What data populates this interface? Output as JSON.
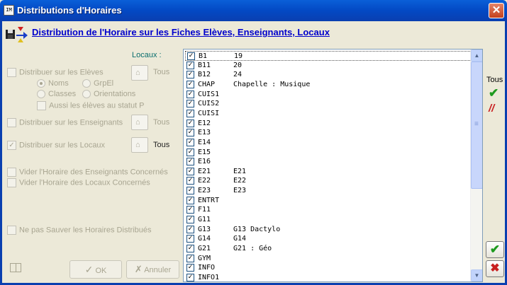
{
  "window": {
    "title": "Distributions d'Horaires",
    "app_icon": "IM",
    "close_symbol": "✕"
  },
  "header": {
    "link_text": "Distribution de l'Horaire sur les Fiches Elèves, Enseignants, Locaux"
  },
  "left": {
    "distribuer_eleves": "Distribuer sur les Elèves",
    "noms": "Noms",
    "grpel": "GrpEl",
    "classes": "Classes",
    "orientations": "Orientations",
    "aussi": "Aussi les élèves au statut P",
    "distribuer_enseignants": "Distribuer sur les Enseignants",
    "distribuer_locaux": "Distribuer sur les Locaux",
    "tous": "Tous",
    "vider_enseignants": "Vider l'Horaire des Enseignants Concernés",
    "vider_locaux": "Vider l'Horaire des Locaux Concernés",
    "ne_pas_sauver": "Ne pas Sauver les Horaires Distribués",
    "ok": "OK",
    "annuler": "Annuler",
    "check_mark": "✓",
    "x_mark": "✗"
  },
  "list": {
    "label": "Locaux :",
    "check_mark": "✓",
    "rows": [
      {
        "code": "B1",
        "desc": "19"
      },
      {
        "code": "B11",
        "desc": "20"
      },
      {
        "code": "B12",
        "desc": "24"
      },
      {
        "code": "CHAP",
        "desc": "Chapelle : Musique"
      },
      {
        "code": "CUIS1",
        "desc": ""
      },
      {
        "code": "CUIS2",
        "desc": ""
      },
      {
        "code": "CUISI",
        "desc": ""
      },
      {
        "code": "E12",
        "desc": ""
      },
      {
        "code": "E13",
        "desc": ""
      },
      {
        "code": "E14",
        "desc": ""
      },
      {
        "code": "E15",
        "desc": ""
      },
      {
        "code": "E16",
        "desc": ""
      },
      {
        "code": "E21",
        "desc": "E21"
      },
      {
        "code": "E22",
        "desc": "E22"
      },
      {
        "code": "E23",
        "desc": "E23"
      },
      {
        "code": "ENTRT",
        "desc": ""
      },
      {
        "code": "F11",
        "desc": ""
      },
      {
        "code": "G11",
        "desc": ""
      },
      {
        "code": "G13",
        "desc": "G13 Dactylo"
      },
      {
        "code": "G14",
        "desc": "G14"
      },
      {
        "code": "G21",
        "desc": "G21 : Géo"
      },
      {
        "code": "GYM",
        "desc": ""
      },
      {
        "code": "INFO",
        "desc": ""
      },
      {
        "code": "INFO1",
        "desc": ""
      }
    ]
  },
  "right": {
    "tous": "Tous",
    "check_mark": "✔",
    "slash_mark": "//",
    "ok_mark": "✔",
    "cancel_mark": "✖"
  },
  "scrollbar": {
    "up_arrow": "▲",
    "down_arrow": "▼"
  },
  "colors": {
    "title_bar": "#0349c4",
    "link": "#0000cc",
    "disabled_text": "#a8a591",
    "check_green": "#1e9a1e",
    "cancel_red": "#c82020"
  }
}
